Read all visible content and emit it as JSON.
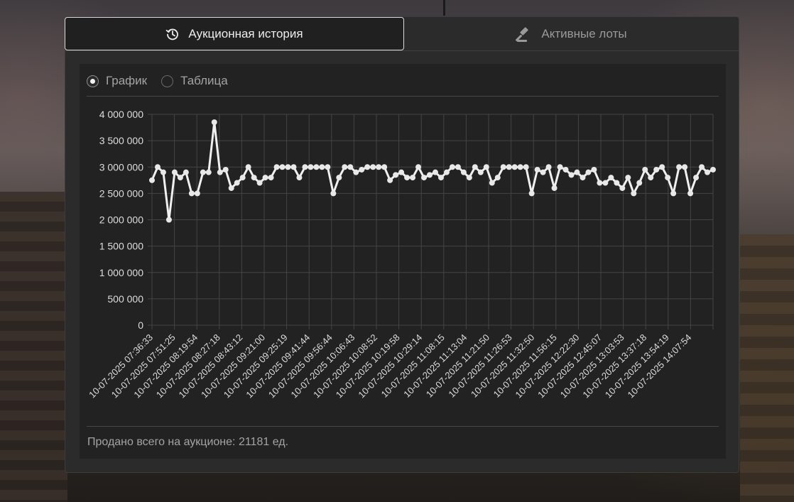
{
  "tabs": [
    {
      "label": "Аукционная история",
      "icon": "history-icon",
      "active": true
    },
    {
      "label": "Активные лоты",
      "icon": "gavel-icon",
      "active": false
    }
  ],
  "view_toggle": [
    {
      "label": "График",
      "selected": true
    },
    {
      "label": "Таблица",
      "selected": false
    }
  ],
  "footer": {
    "label": "Продано всего на аукционе:",
    "value": "21181",
    "unit": "ед."
  },
  "chart_data": {
    "type": "line",
    "title": "",
    "xlabel": "",
    "ylabel": "",
    "ylim": [
      0,
      4000000
    ],
    "yticks": [
      "4 000 000",
      "3 500 000",
      "3 000 000",
      "2 500 000",
      "2 000 000",
      "1 500 000",
      "1 000 000",
      "500 000",
      "0"
    ],
    "grid": true,
    "legend": "none",
    "colors": {
      "line": "#f0f0f0",
      "grid": "#444444",
      "tick_text": "#dddddd"
    },
    "xtick_labels": [
      "10-07-2025 07:36:33",
      "10-07-2025 07:51:25",
      "10-07-2025 08:19:54",
      "10-07-2025 08:27:18",
      "10-07-2025 08:43:12",
      "10-07-2025 09:21:00",
      "10-07-2025 09:25:19",
      "10-07-2025 09:41:44",
      "10-07-2025 09:56:44",
      "10-07-2025 10:06:43",
      "10-07-2025 10:08:52",
      "10-07-2025 10:19:58",
      "10-07-2025 10:29:14",
      "10-07-2025 11:08:15",
      "10-07-2025 11:13:04",
      "10-07-2025 11:21:50",
      "10-07-2025 11:26:53",
      "10-07-2025 11:32:50",
      "10-07-2025 11:56:15",
      "10-07-2025 12:22:30",
      "10-07-2025 12:45:07",
      "10-07-2025 13:03:53",
      "10-07-2025 13:37:18",
      "10-07-2025 13:54:19",
      "10-07-2025 14:07:54"
    ],
    "values": [
      2750000,
      3000000,
      2900000,
      2000000,
      2900000,
      2800000,
      2900000,
      2500000,
      2500000,
      2900000,
      2900000,
      3850000,
      2900000,
      2950000,
      2600000,
      2700000,
      2800000,
      3000000,
      2800000,
      2700000,
      2800000,
      2800000,
      3000000,
      3000000,
      3000000,
      3000000,
      2800000,
      3000000,
      3000000,
      3000000,
      3000000,
      3000000,
      2500000,
      2800000,
      3000000,
      3000000,
      2900000,
      2950000,
      3000000,
      3000000,
      3000000,
      3000000,
      2750000,
      2850000,
      2900000,
      2800000,
      2800000,
      3000000,
      2800000,
      2850000,
      2900000,
      2800000,
      2900000,
      3000000,
      3000000,
      2900000,
      2800000,
      3000000,
      2900000,
      3000000,
      2700000,
      2800000,
      3000000,
      3000000,
      3000000,
      3000000,
      3000000,
      2500000,
      2950000,
      2900000,
      3000000,
      2600000,
      3000000,
      2950000,
      2850000,
      2900000,
      2800000,
      2900000,
      2950000,
      2700000,
      2700000,
      2800000,
      2700000,
      2600000,
      2800000,
      2500000,
      2700000,
      2950000,
      2800000,
      2950000,
      3000000,
      2800000,
      2500000,
      3000000,
      3000000,
      2500000,
      2800000,
      3000000,
      2900000,
      2950000
    ]
  }
}
